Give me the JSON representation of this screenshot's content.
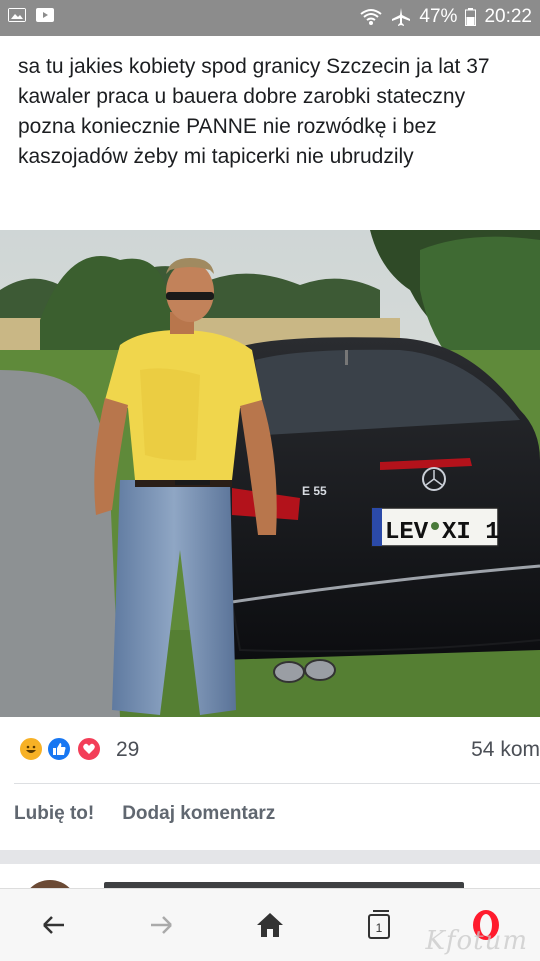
{
  "status_bar": {
    "battery": "47%",
    "time": "20:22"
  },
  "post": {
    "text": "sa tu jakies kobiety spod granicy Szczecin ja lat 37 kawaler praca u bauera dobre zarobki stateczny pozna koniecznie PANNE nie rozwódkę i bez kaszojadów żeby mi tapicerki nie ubrudzily",
    "photo": {
      "plate_prefix": "LEV",
      "plate_suffix": "XI 1",
      "car_badge": "E 55"
    }
  },
  "reactions": {
    "icons": [
      "haha-icon",
      "like-icon",
      "love-icon"
    ],
    "count": "29",
    "comments": "54 kom"
  },
  "actions": {
    "like_label": "Lubię to!",
    "comment_label": "Dodaj komentarz"
  },
  "colors": {
    "status_bar": "#8c8c8c",
    "like": "#1877f2",
    "love": "#f33e58",
    "haha": "#f7b125",
    "opera_red": "#ff1b2d"
  },
  "watermark": "Kfotum"
}
